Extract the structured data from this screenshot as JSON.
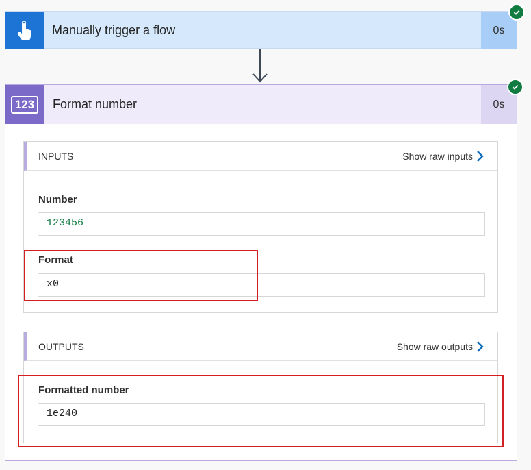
{
  "trigger": {
    "title": "Manually trigger a flow",
    "duration": "0s",
    "status": "succeeded",
    "icon": "touch-hand-icon"
  },
  "action": {
    "title": "Format number",
    "duration": "0s",
    "status": "succeeded",
    "icon_text": "123",
    "inputs": {
      "label": "INPUTS",
      "raw_link": "Show raw inputs",
      "fields": [
        {
          "label": "Number",
          "value": "123456"
        },
        {
          "label": "Format",
          "value": "x0"
        }
      ]
    },
    "outputs": {
      "label": "OUTPUTS",
      "raw_link": "Show raw outputs",
      "fields": [
        {
          "label": "Formatted number",
          "value": "1e240"
        }
      ]
    }
  },
  "colors": {
    "trigger_accent": "#1d74d4",
    "action_accent": "#7b6ac7",
    "success": "#107c41",
    "highlight": "#d21f24"
  }
}
